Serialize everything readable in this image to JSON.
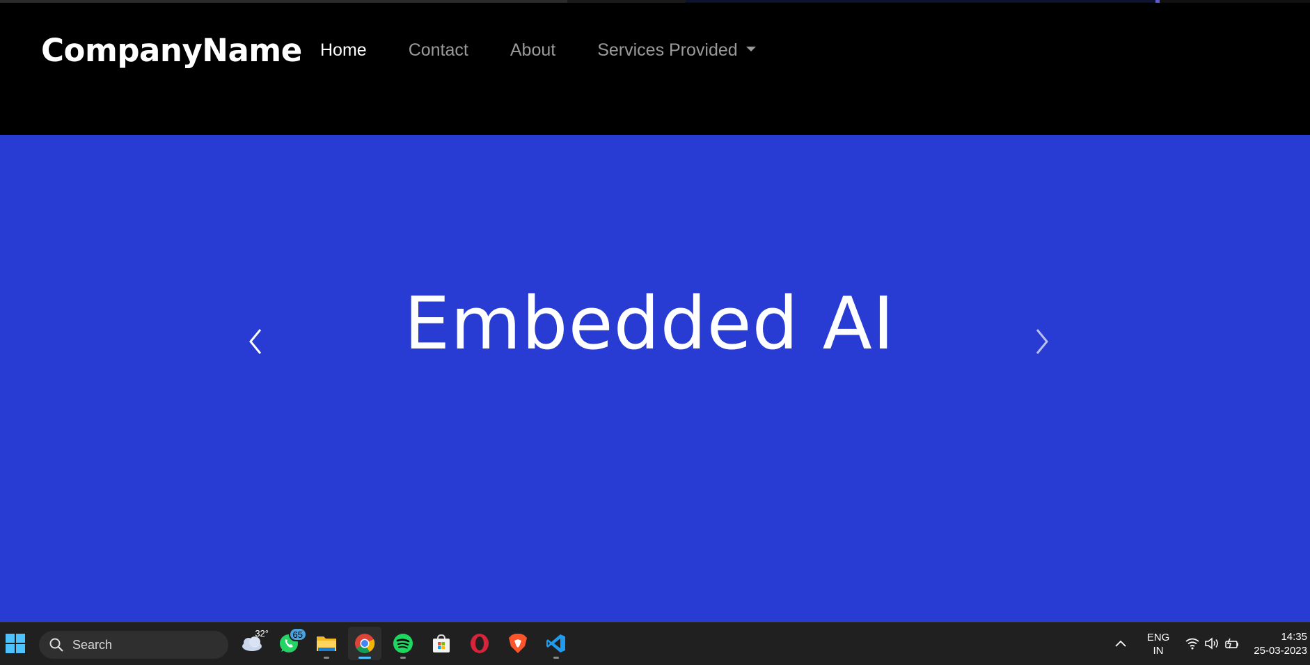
{
  "navbar": {
    "brand": "CompanyName",
    "links": [
      {
        "label": "Home",
        "active": true
      },
      {
        "label": "Contact",
        "active": false
      },
      {
        "label": "About",
        "active": false
      },
      {
        "label": "Services Provided",
        "active": false,
        "dropdown": true
      }
    ]
  },
  "hero": {
    "title": "Embedded AI",
    "background_color": "#283bd3",
    "prev_icon": "chevron-left-icon",
    "next_icon": "chevron-right-icon"
  },
  "taskbar": {
    "search_label": "Search",
    "weather_temp": "32°",
    "whatsapp_badge": "65",
    "apps": [
      "start-icon",
      "weather-icon",
      "whatsapp-icon",
      "file-explorer-icon",
      "chrome-icon",
      "spotify-icon",
      "store-icon",
      "opera-icon",
      "brave-icon",
      "vscode-icon"
    ],
    "language_line1": "ENG",
    "language_line2": "IN",
    "time": "14:35",
    "date": "25-03-2023"
  }
}
